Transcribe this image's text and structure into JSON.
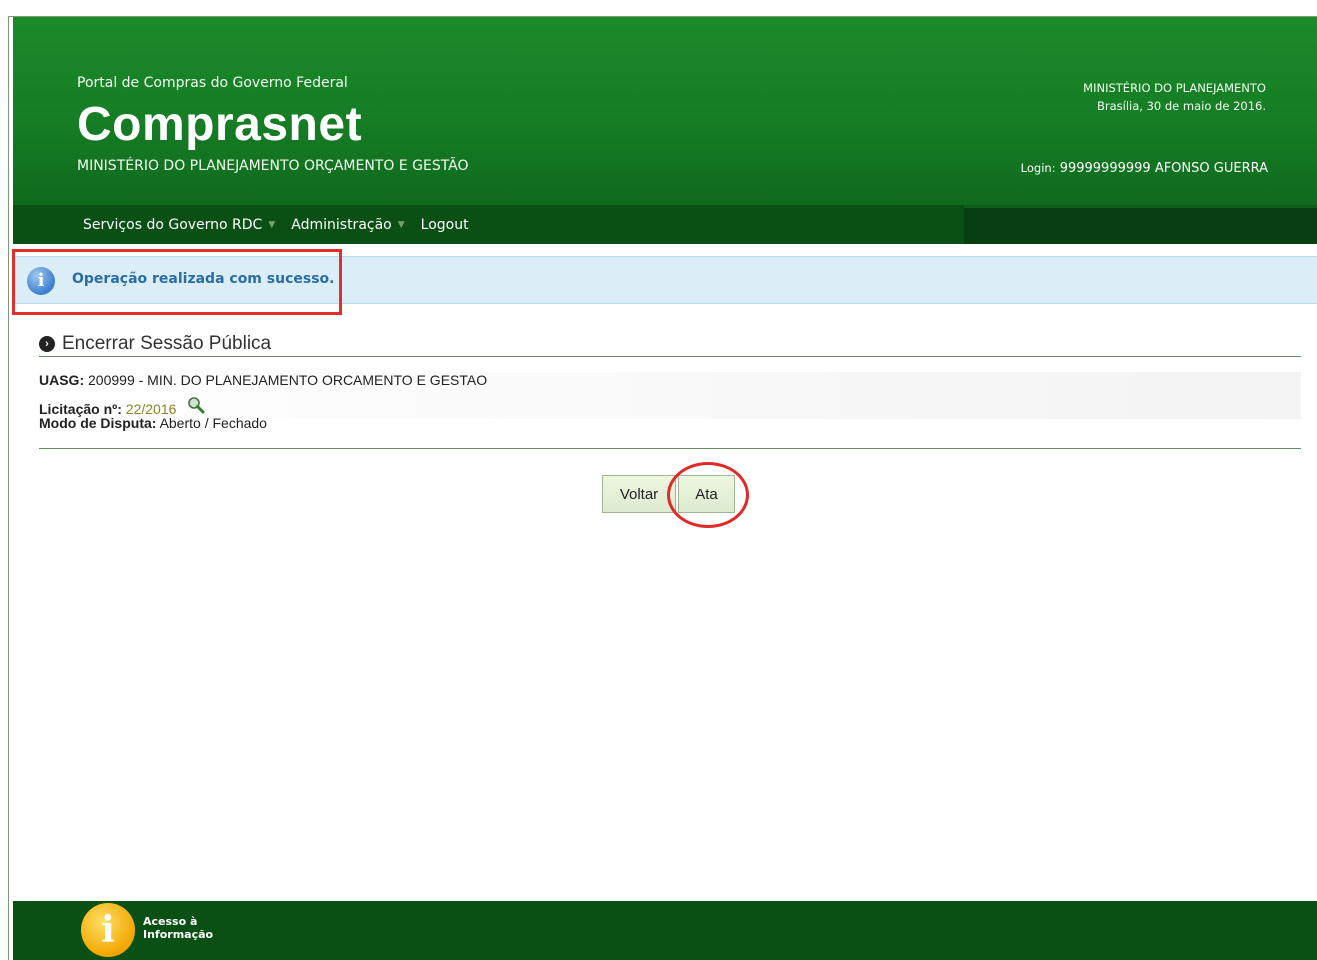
{
  "header": {
    "portal_label": "Portal de Compras do Governo Federal",
    "brand": "Comprasnet",
    "ministry": "MINISTÉRIO DO PLANEJAMENTO ORÇAMENTO E GESTÃO",
    "right_ministry": "MINISTÉRIO DO PLANEJAMENTO",
    "date": "Brasília, 30 de maio de 2016.",
    "login_label": "Login:",
    "login_value": "99999999999 AFONSO GUERRA"
  },
  "nav": {
    "items": [
      {
        "label": "Serviços do Governo RDC",
        "has_caret": true
      },
      {
        "label": "Administração",
        "has_caret": true
      },
      {
        "label": "Logout",
        "has_caret": false
      }
    ]
  },
  "alert": {
    "message": "Operação realizada com sucesso.",
    "icon": "info-icon"
  },
  "section": {
    "title": "Encerrar Sessão Pública",
    "icon": "arrow-right-circle-icon"
  },
  "details": {
    "uasg_label": "UASG:",
    "uasg_value": "200999 - MIN. DO PLANEJAMENTO ORCAMENTO E GESTAO",
    "licitacao_label": "Licitação nº:",
    "licitacao_value": "22/2016",
    "modo_label": "Modo de Disputa:",
    "modo_value": "Aberto / Fechado"
  },
  "buttons": {
    "voltar": "Voltar",
    "ata": "Ata"
  },
  "footer": {
    "access_line1": "Acesso à",
    "access_line2": "Informação",
    "icon": "info-icon"
  },
  "colors": {
    "header_green": "#167d25",
    "nav_dark": "#0a4f14",
    "alert_bg": "#dbeef7",
    "highlight_red": "#e0302e",
    "link_olive": "#8d8526"
  }
}
